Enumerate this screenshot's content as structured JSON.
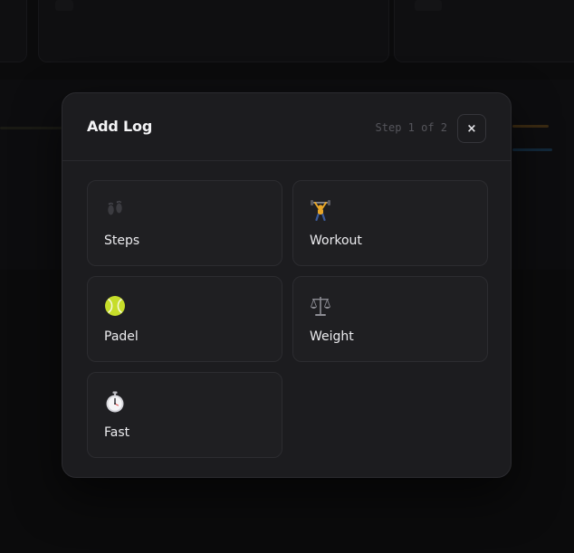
{
  "modal": {
    "title": "Add Log",
    "step_indicator": "Step 1 of 2",
    "close_label": "×"
  },
  "options": [
    {
      "label": "Steps",
      "icon": "footprints-icon"
    },
    {
      "label": "Workout",
      "icon": "weightlifter-icon"
    },
    {
      "label": "Padel",
      "icon": "tennis-ball-icon"
    },
    {
      "label": "Weight",
      "icon": "scales-icon"
    },
    {
      "label": "Fast",
      "icon": "stopwatch-icon"
    }
  ],
  "colors": {
    "modal_background": "#1c1c1f",
    "card_background": "#1f1f22",
    "card_border": "#2c2c30",
    "text_primary": "#ececef",
    "text_muted": "#55555b",
    "tennis_ball": "#c6dd2a",
    "workout_gold": "#e8a628"
  }
}
